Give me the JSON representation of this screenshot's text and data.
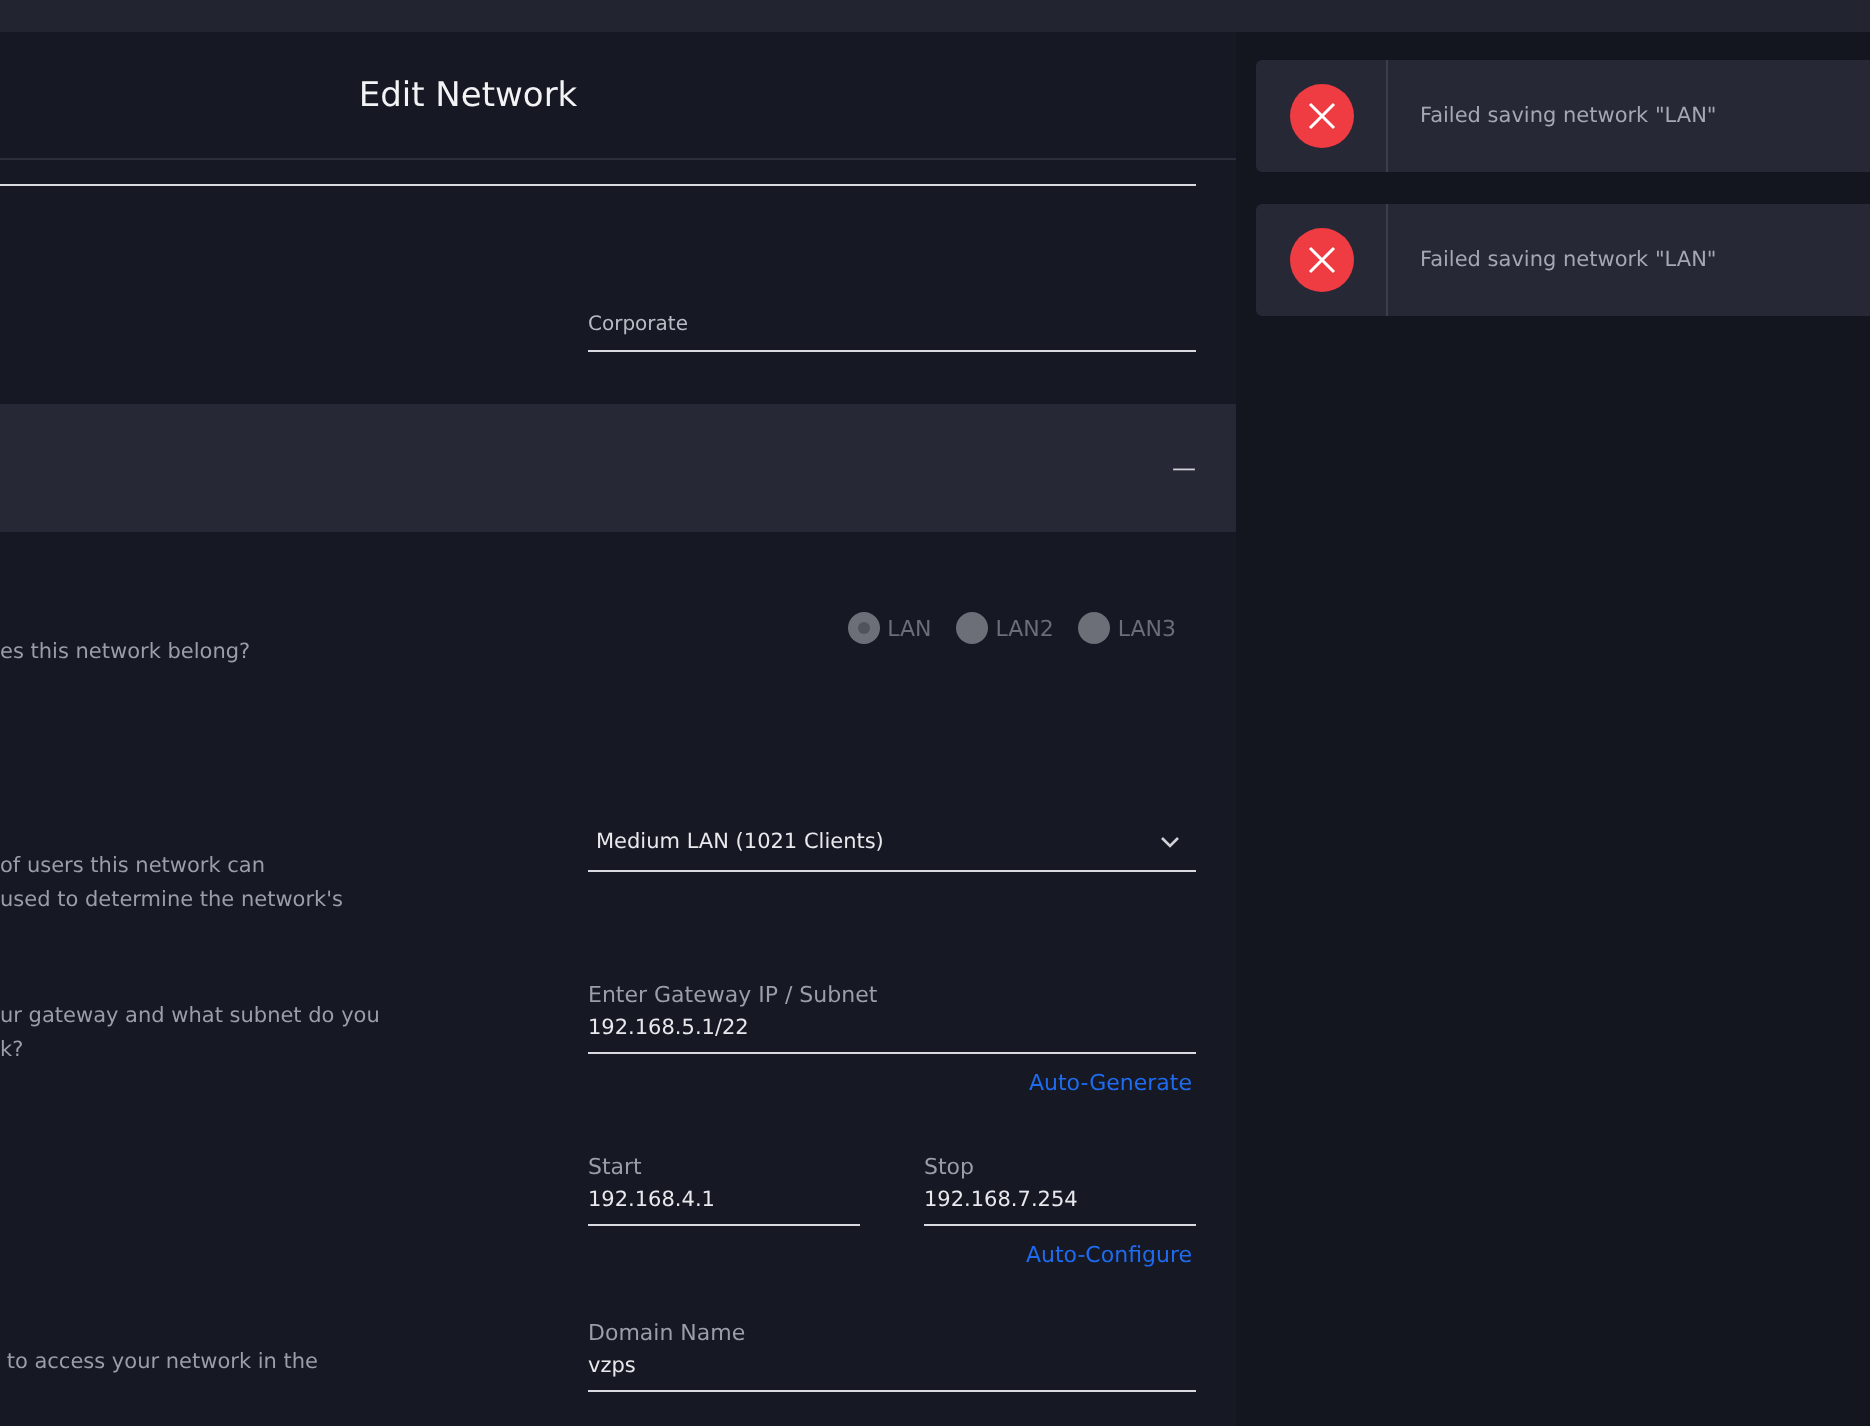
{
  "modal": {
    "title": "Edit Network"
  },
  "purpose_field": {
    "value": "Corporate"
  },
  "section": {
    "collapse_symbol": "—",
    "expanded": true
  },
  "port_question": {
    "description": "es this network belong?",
    "options": [
      {
        "label": "LAN",
        "selected": true
      },
      {
        "label": "LAN2",
        "selected": false
      },
      {
        "label": "LAN3",
        "selected": false
      }
    ]
  },
  "size_question": {
    "description": [
      "of users this network can",
      "used to determine the network's"
    ],
    "value": "Medium LAN (1021 Clients)"
  },
  "gateway_question": {
    "description": [
      "ur gateway and what subnet do you",
      "k?"
    ],
    "label": "Enter Gateway IP / Subnet",
    "value": "192.168.5.1/22",
    "link": "Auto-Generate"
  },
  "dhcp_range": {
    "start_label": "Start",
    "start_value": "192.168.4.1",
    "stop_label": "Stop",
    "stop_value": "192.168.7.254",
    "link": "Auto-Configure"
  },
  "domain_question": {
    "description": " to access your network in the",
    "label": "Domain Name",
    "value": "vzps"
  },
  "toasts": [
    {
      "message": "Failed saving network \"LAN\""
    },
    {
      "message": "Failed saving network \"LAN\""
    }
  ]
}
